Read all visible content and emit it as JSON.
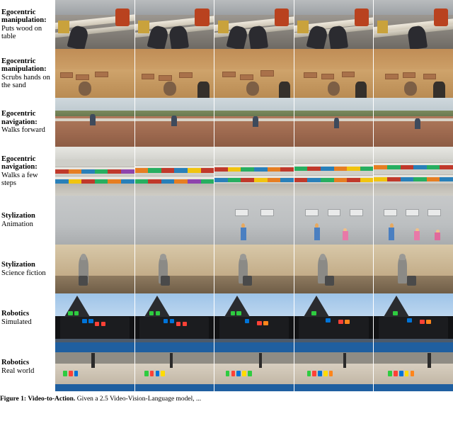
{
  "figure": {
    "rows": [
      {
        "id": "egocentric-manipulation-wood",
        "title": "Egocentric manipulation:",
        "subtitle": "Puts wood on table",
        "frame_count": 5,
        "scene": "first-person view of hands placing a long wooden board onto a table outdoors, gray concrete background, yellow box at left, orange safety vest at right"
      },
      {
        "id": "egocentric-manipulation-sand",
        "title": "Egocentric manipulation:",
        "subtitle": "Scrubs hands on the sand",
        "frame_count": 5,
        "scene": "first-person view of hands rubbing sand, mud bricks laid out on sandy ground"
      },
      {
        "id": "egocentric-navigation-forward",
        "title": "Egocentric navigation:",
        "subtitle": "Walks forward",
        "frame_count": 5,
        "scene": "fisheye first-person view walking forward along a brick path with trees and a person ahead"
      },
      {
        "id": "egocentric-navigation-few-steps",
        "title": "Egocentric navigation:",
        "subtitle": "Walks a few steps",
        "frame_count": 5,
        "scene": "first-person view walking down a grocery store aisle with stocked shelves"
      },
      {
        "id": "stylization-animation",
        "title": "Stylization",
        "subtitle": "Animation",
        "frame_count": 5,
        "scene": "flat animated style gray room with wall panels and cartoon characters appearing"
      },
      {
        "id": "stylization-science-fiction",
        "title": "Stylization",
        "subtitle": "Science fiction",
        "frame_count": 5,
        "scene": "sepia desert scene with a tall droid figure and a small rover on sand"
      },
      {
        "id": "robotics-simulated",
        "title": "Robotics",
        "subtitle": "Simulated",
        "frame_count": 5,
        "scene": "simulated robot arm over a black table with green, blue and red colored blocks"
      },
      {
        "id": "robotics-real-world",
        "title": "Robotics",
        "subtitle": "Real world",
        "frame_count": 5,
        "scene": "real world robot gripper over a light wooden table with colored cubes, blue backdrop"
      }
    ],
    "caption": {
      "label": "Figure 1:",
      "bold_lead": "Video-to-Action.",
      "text": "Given a 2.5 Video-Vision-Language model, ..."
    }
  }
}
